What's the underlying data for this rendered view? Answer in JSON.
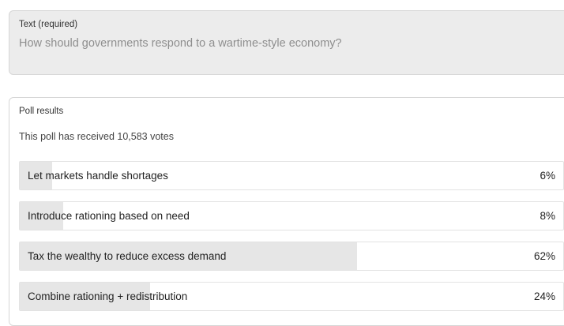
{
  "text_field": {
    "label": "Text (required)",
    "value": "How should governments respond to a wartime-style economy?"
  },
  "poll": {
    "title": "Poll results",
    "votes_text": "This poll has received 10,583 votes",
    "options": [
      {
        "label": "Let markets handle shortages",
        "percent": 6,
        "percent_text": "6%"
      },
      {
        "label": "Introduce rationing based on need",
        "percent": 8,
        "percent_text": "8%"
      },
      {
        "label": "Tax the wealthy to reduce excess demand",
        "percent": 62,
        "percent_text": "62%"
      },
      {
        "label": "Combine rationing + redistribution",
        "percent": 24,
        "percent_text": "24%"
      }
    ]
  }
}
